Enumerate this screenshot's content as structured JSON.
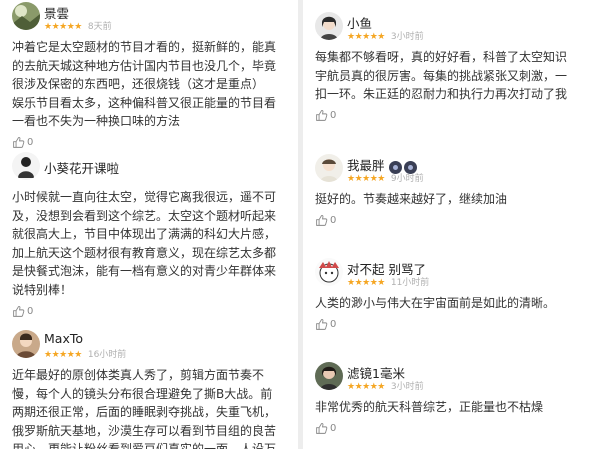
{
  "left_reviews": [
    {
      "name": "景雲",
      "stars": "★★★★★",
      "time": "8天前",
      "lines": [
        "冲着它是太空题材的节目才看的，挺新鲜的，能真",
        "的去航天城这种地方估计国内节目也没几个，毕竟",
        "很涉及保密的东西吧，还很烧钱（这才是重点）",
        "娱乐节目看太多，这种偏科普又很正能量的节目看",
        "一看也不失为一种换口味的方法"
      ],
      "likes": "0"
    },
    {
      "name": "小葵花开课啦",
      "stars": "",
      "time": "",
      "lines": [
        "小时候就一直向往太空，觉得它离我很远，遥不可",
        "及，没想到会看到这个综艺。太空这个题材听起来",
        "就很高大上，节目中体现出了满满的科幻大片感，",
        "加上航天这个题材很有教育意义，现在综艺太多都",
        "是快餐式泡沫，能有一档有意义的对青少年群体来",
        "说特别棒！"
      ],
      "likes": "0"
    },
    {
      "name": "MaxTo",
      "stars": "★★★★★",
      "time": "16小时前",
      "lines": [
        "近年最好的原创体类真人秀了，剪辑方面节奏不",
        "慢，每个人的镜头分布很合理避免了撕B大战。前",
        "两期还很正常，后面的睡眠剥夺挑战，失重飞机，",
        "俄罗斯航天基地，沙漠生存可以看到节目组的良苦",
        "用心。更能让粉丝看到爱豆们真实的一面。人设万"
      ],
      "likes": ""
    }
  ],
  "right_reviews": [
    {
      "name": "小鱼",
      "stars": "★★★★★",
      "time": "3小时前",
      "lines": [
        "每集都不够看呀，真的好好看，科普了太空知识",
        "宇航员真的很厉害。每集的挑战紧张又刺激，一",
        "扣一环。朱正廷的忍耐力和执行力再次打动了我"
      ],
      "likes": "0"
    },
    {
      "name": "我最胖",
      "stars": "★★★★★",
      "time": "9小时前",
      "lines": [
        "挺好的。节奏越来越好了，继续加油"
      ],
      "likes": "0"
    },
    {
      "name": "对不起 别骂了",
      "stars": "★★★★★",
      "time": "11小时前",
      "lines": [
        "人类的渺小与伟大在宇宙面前是如此的清晰。"
      ],
      "likes": "0"
    },
    {
      "name": "滤镜1毫米",
      "stars": "★★★★★",
      "time": "3小时前",
      "lines": [
        "非常优秀的航天科普综艺，正能量也不枯燥"
      ],
      "likes": "0"
    }
  ],
  "colors": {
    "star": "#f5a623",
    "meta": "#b0b0b0",
    "text": "#333333"
  },
  "icons": {
    "like": "thumbs-up-icon",
    "badge": "medal-badge-icon"
  }
}
